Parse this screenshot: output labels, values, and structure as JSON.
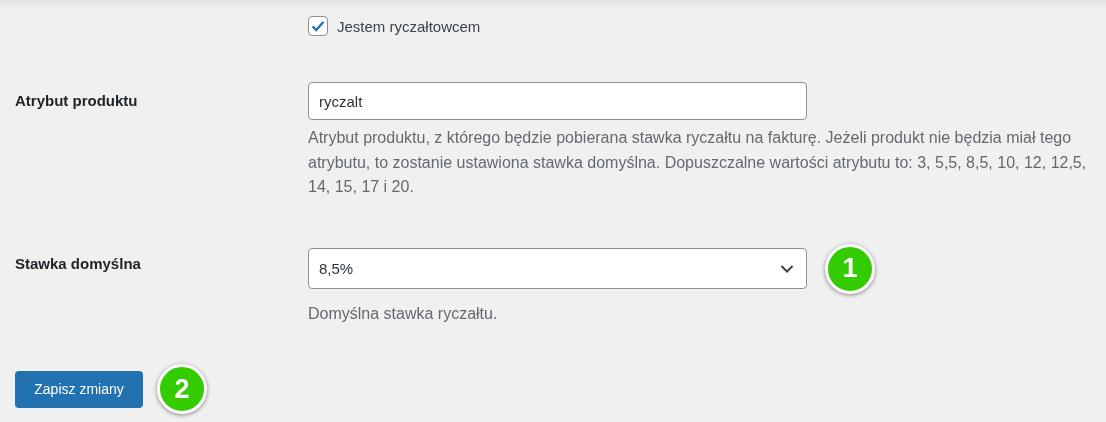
{
  "checkbox": {
    "label": "Jestem ryczałtowcem",
    "checked": true
  },
  "fields": [
    {
      "kind": "text",
      "label": "Atrybut produktu",
      "value": "ryczalt",
      "description": "Atrybut produktu, z którego będzie pobierana stawka ryczałtu na fakturę. Jeżeli produkt nie będzia miał tego atrybutu, to zostanie ustawiona stawka domyślna. Dopuszczalne wartości atrybutu to: 3, 5,5, 8,5, 10, 12, 12,5, 14, 15, 17 i 20."
    },
    {
      "kind": "select",
      "label": "Stawka domyślna",
      "value": "8,5%",
      "description": "Domyślna stawka ryczałtu.",
      "badge": "1"
    }
  ],
  "save_button": {
    "label": "Zapisz zmiany",
    "badge": "2"
  }
}
